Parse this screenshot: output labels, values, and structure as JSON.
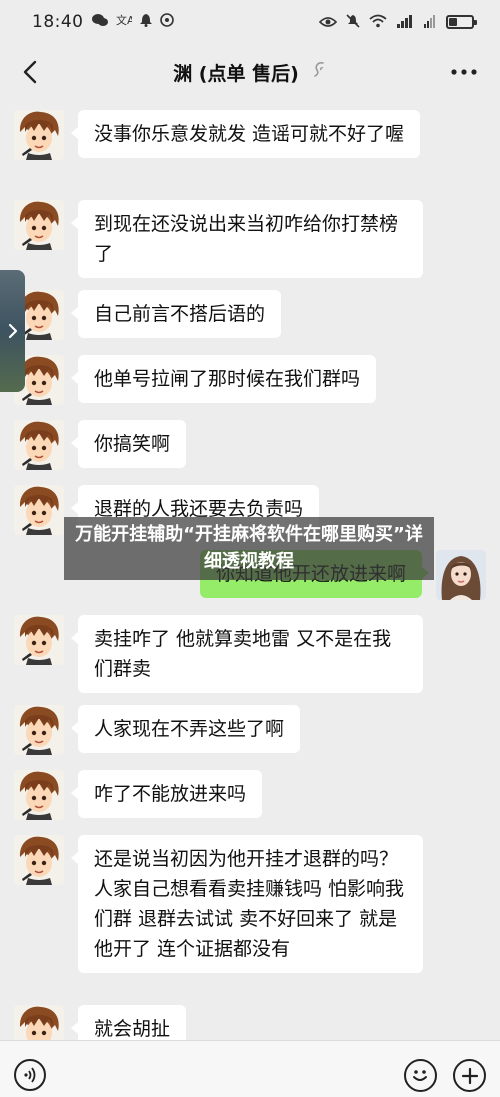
{
  "status_bar": {
    "time": "18:40",
    "left_icons": [
      "wechat-icon",
      "translate-icon",
      "bell-icon",
      "nfc-icon"
    ],
    "right_icons": [
      "eye-icon",
      "mute-icon",
      "wifi-icon",
      "signal-icon",
      "signal-icon-2"
    ],
    "battery_level": 0.35
  },
  "nav": {
    "title": "渊 (点单 售后)",
    "back_icon": "chevron-left-icon",
    "earpiece_icon": "earpiece-icon",
    "more_icon": "more-icon"
  },
  "messages": [
    {
      "side": "in",
      "text": "没事你乐意发就发 造谣可就不好了喔"
    },
    {
      "side": "in",
      "text": "到现在还没说出来当初咋给你打禁榜了"
    },
    {
      "side": "in",
      "text": "自己前言不搭后语的"
    },
    {
      "side": "in",
      "text": "他单号拉闸了那时候在我们群吗"
    },
    {
      "side": "in",
      "text": "你搞笑啊"
    },
    {
      "side": "in",
      "text": "退群的人我还要去负责吗"
    },
    {
      "side": "out",
      "text": "你知道他开还放进来啊"
    },
    {
      "side": "in",
      "text": "卖挂咋了 他就算卖地雷 又不是在我们群卖"
    },
    {
      "side": "in",
      "text": "人家现在不弄这些了啊"
    },
    {
      "side": "in",
      "text": "咋了不能放进来吗"
    },
    {
      "side": "in",
      "text": "还是说当初因为他开挂才退群的吗？ 人家自己想看看卖挂赚钱吗 怕影响我们群 退群去试试 卖不好回来了 就是他开了 连个证据都没有"
    },
    {
      "side": "in",
      "text": "就会胡扯"
    }
  ],
  "overlay": {
    "text": "万能开挂辅助“开挂麻将软件在哪里购买”详细透视教程"
  },
  "input_bar": {
    "voice_icon": "voice-icon",
    "emoji_icon": "emoji-icon",
    "plus_icon": "plus-icon"
  },
  "colors": {
    "background": "#ededed",
    "incoming_bubble": "#ffffff",
    "outgoing_bubble": "#95ec69"
  }
}
